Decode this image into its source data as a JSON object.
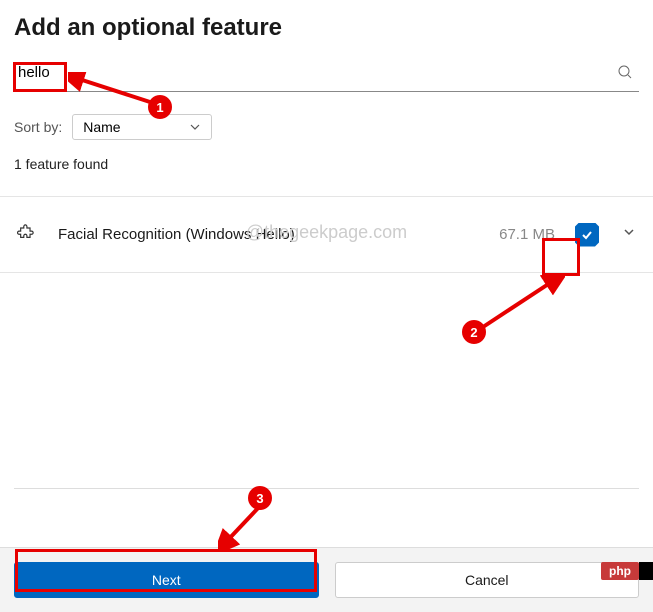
{
  "header": {
    "title": "Add an optional feature"
  },
  "search": {
    "value": "hello",
    "placeholder": ""
  },
  "sort": {
    "label": "Sort by:",
    "selected": "Name"
  },
  "results": {
    "count_text": "1 feature found"
  },
  "watermark": "@thegeekpage.com",
  "features": [
    {
      "name": "Facial Recognition (Windows Hello)",
      "size": "67.1 MB",
      "checked": true
    }
  ],
  "footer": {
    "next": "Next",
    "cancel": "Cancel"
  },
  "badge": "php",
  "annotations": {
    "n1": "1",
    "n2": "2",
    "n3": "3"
  }
}
